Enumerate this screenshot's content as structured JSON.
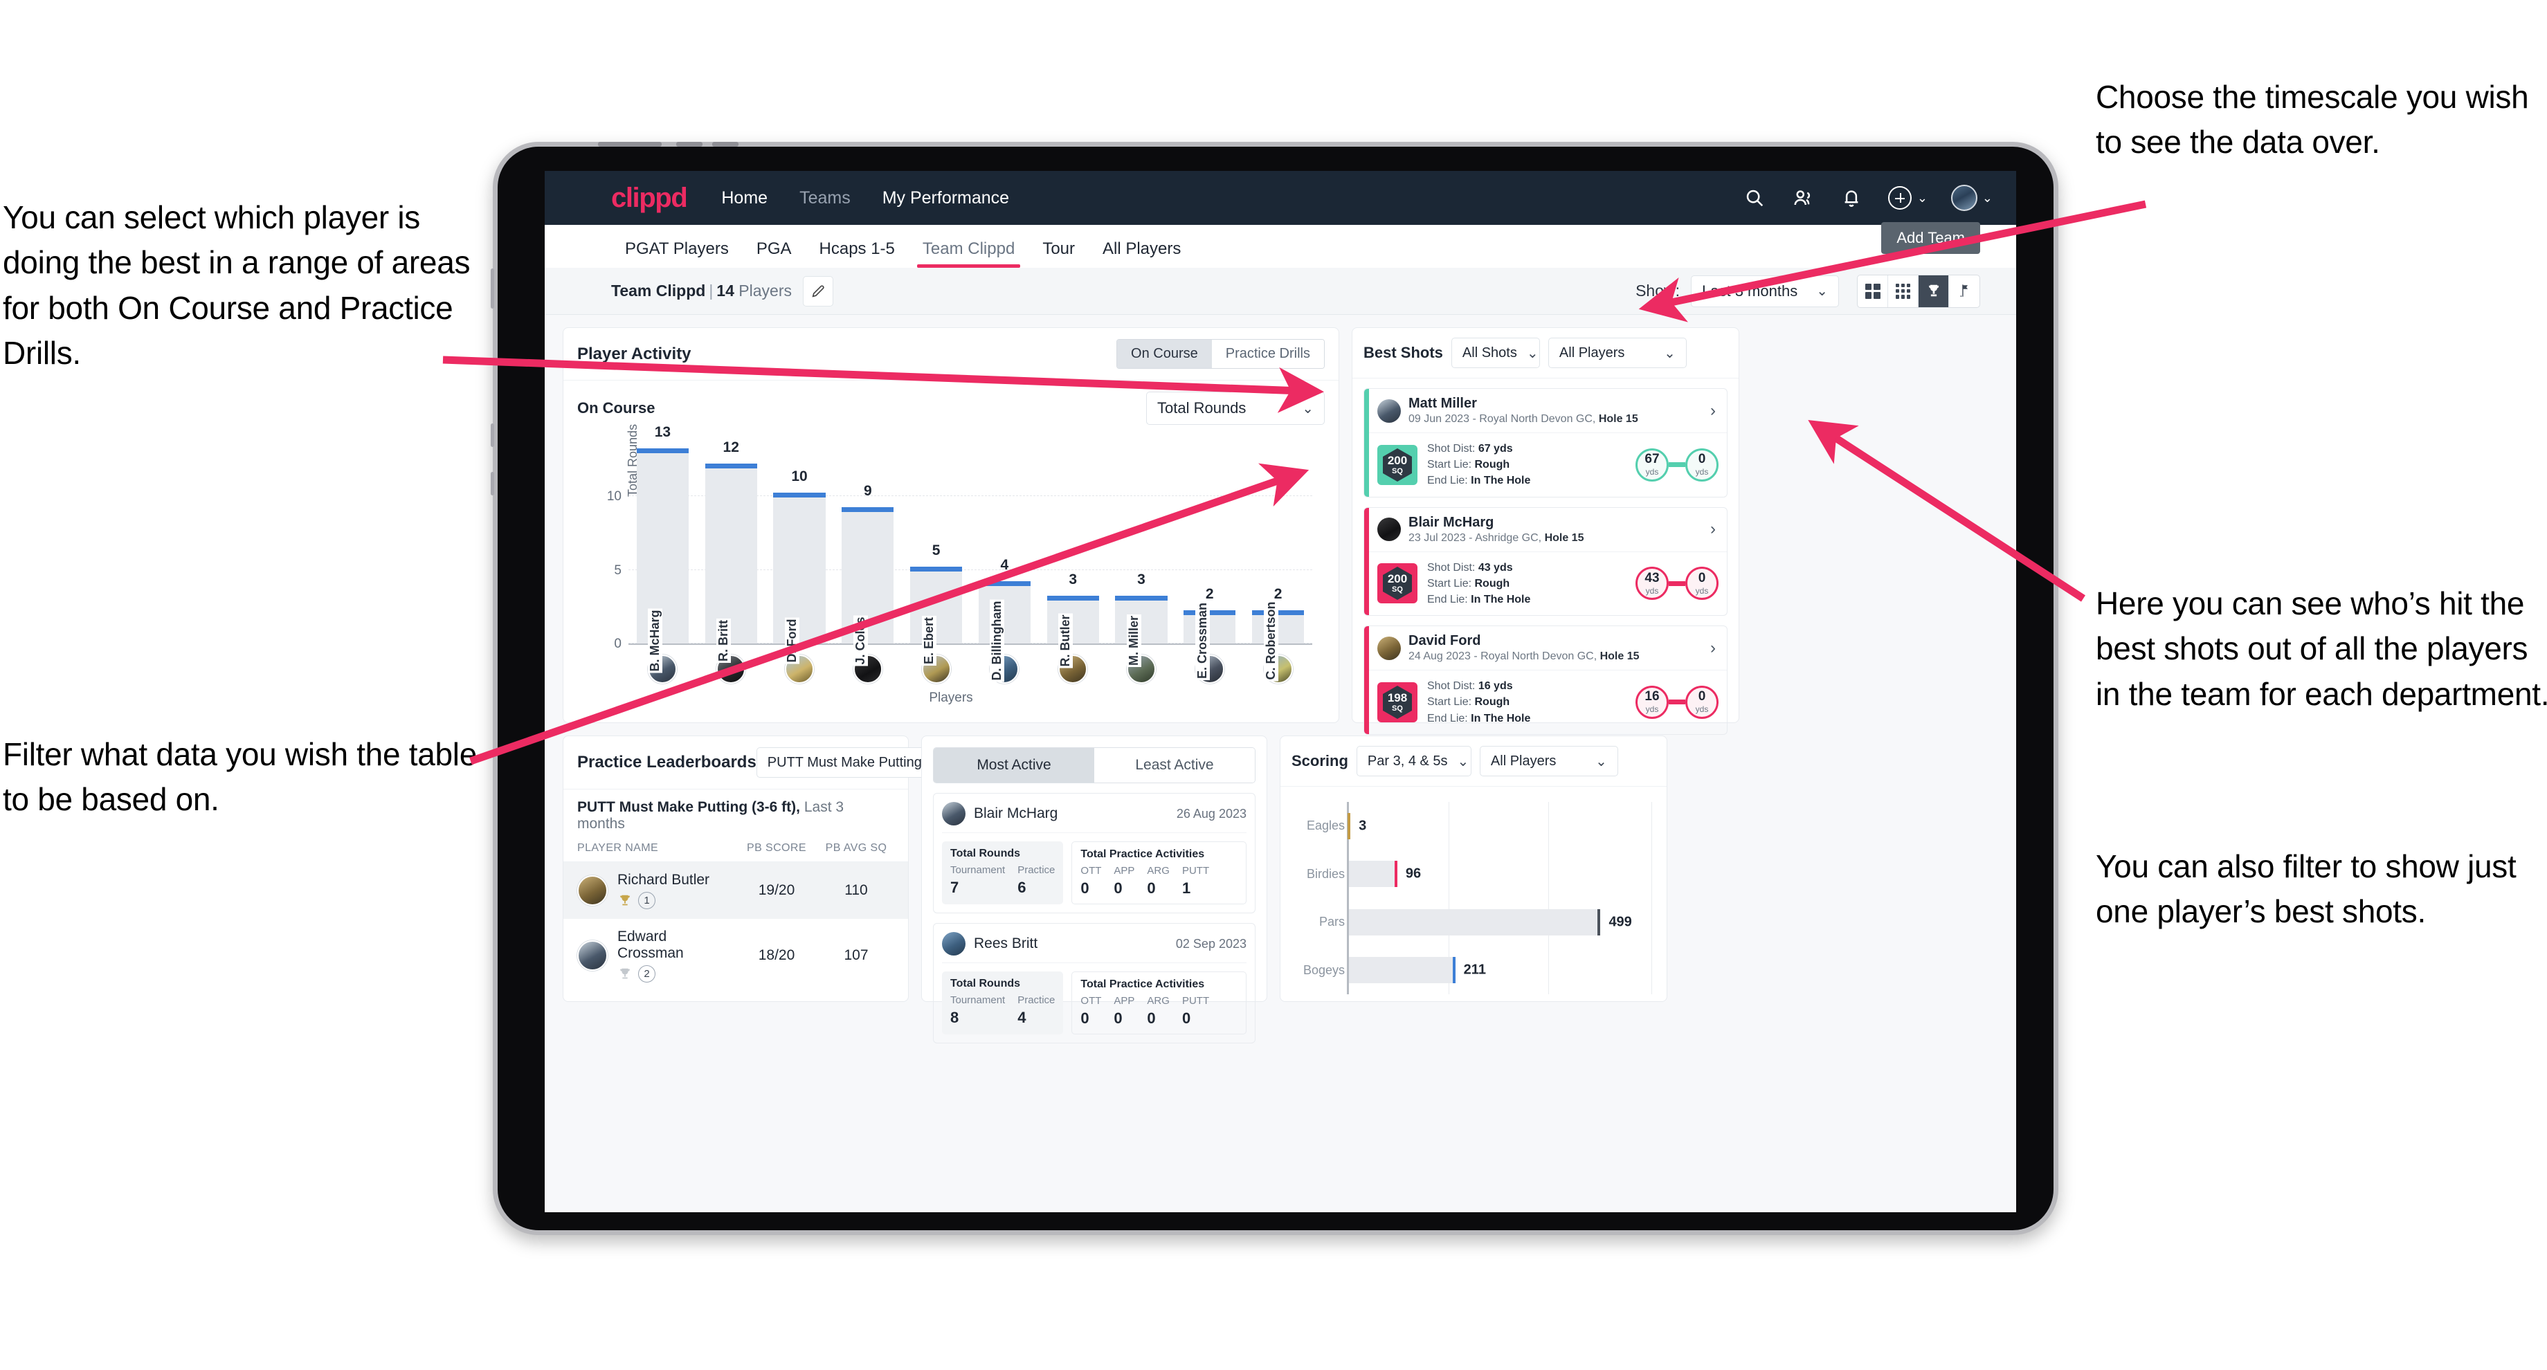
{
  "annotations": {
    "left_top": "You can select which player is doing the best in a range of areas for both On Course and Practice Drills.",
    "left_bottom": "Filter what data you wish the table to be based on.",
    "right_top": "Choose the timescale you wish to see the data over.",
    "right_middle": "Here you can see who’s hit the best shots out of all the players in the team for each department.",
    "right_bottom": "You can also filter to show just one player’s best shots."
  },
  "topnav": {
    "logo": "clippd",
    "links": [
      {
        "label": "Home",
        "dim": false
      },
      {
        "label": "Teams",
        "dim": true
      },
      {
        "label": "My Performance",
        "dim": false
      }
    ],
    "icons": [
      "search-icon",
      "people-icon",
      "bell-icon",
      "plus-circle-icon",
      "avatar"
    ]
  },
  "tabs": [
    {
      "label": "PGAT Players",
      "active": false
    },
    {
      "label": "PGA",
      "active": false
    },
    {
      "label": "Hcaps 1-5",
      "active": false
    },
    {
      "label": "Team Clippd",
      "active": true
    },
    {
      "label": "Tour",
      "active": false
    },
    {
      "label": "All Players",
      "active": false
    }
  ],
  "add_team_button": "Add Team",
  "subheader": {
    "team_label": "Team Clippd",
    "separator": "|",
    "player_count": "14",
    "players_word": "Players",
    "edit_icon": "pencil-icon",
    "show_label": "Show:",
    "show_value": "Last 3 months",
    "view_buttons": [
      "grid-4-icon",
      "grid-9-icon",
      "trophy-icon",
      "flag-icon"
    ],
    "view_selected_index": 2
  },
  "player_activity": {
    "title": "Player Activity",
    "segments": [
      {
        "label": "On Course",
        "active": true
      },
      {
        "label": "Practice Drills",
        "active": false
      }
    ],
    "sub_label": "On Course",
    "metric_select": "Total Rounds"
  },
  "chart_data": [
    {
      "type": "bar",
      "title": "Player Activity",
      "xlabel": "Players",
      "ylabel": "Total Rounds",
      "categories": [
        "B. McHarg",
        "R. Britt",
        "D. Ford",
        "J. Coles",
        "E. Ebert",
        "D. Billingham",
        "R. Butler",
        "M. Miller",
        "E. Crossman",
        "C. Robertson"
      ],
      "values": [
        13,
        12,
        10,
        9,
        5,
        4,
        3,
        3,
        2,
        2
      ],
      "ylim": [
        0,
        14
      ],
      "yticks": [
        0,
        5,
        10
      ],
      "grid": true,
      "bar_color": "#e7eaee",
      "cap_color": "#3d7fd6"
    },
    {
      "type": "bar",
      "title": "Scoring",
      "orientation": "horizontal",
      "categories": [
        "Eagles",
        "Birdies",
        "Pars",
        "Bogeys"
      ],
      "values": [
        3,
        96,
        499,
        211
      ],
      "xlim": [
        0,
        600
      ],
      "grid": true,
      "bar_color": "#e8eaee",
      "tip_colors": [
        "#c39b45",
        "#ec2b62",
        "#4b525c",
        "#3d7fd6"
      ]
    }
  ],
  "best_shots": {
    "title": "Best Shots",
    "shots_filter": "All Shots",
    "players_filter": "All Players",
    "items": [
      {
        "player": "Matt Miller",
        "meta_date": "09 Jun 2023 - Royal North Devon GC,",
        "meta_hole": "Hole 15",
        "sq": "200",
        "sq_unit": "SQ",
        "accent": "#54cfae",
        "shot_dist_label": "Shot Dist:",
        "shot_dist": "67 yds",
        "start_lie_label": "Start Lie:",
        "start_lie": "Rough",
        "end_lie_label": "End Lie:",
        "end_lie": "In The Hole",
        "from_value": "67",
        "from_unit": "yds",
        "to_value": "0",
        "to_unit": "yds"
      },
      {
        "player": "Blair McHarg",
        "meta_date": "23 Jul 2023 - Ashridge GC,",
        "meta_hole": "Hole 15",
        "sq": "200",
        "sq_unit": "SQ",
        "accent": "#ec2b62",
        "shot_dist_label": "Shot Dist:",
        "shot_dist": "43 yds",
        "start_lie_label": "Start Lie:",
        "start_lie": "Rough",
        "end_lie_label": "End Lie:",
        "end_lie": "In The Hole",
        "from_value": "43",
        "from_unit": "yds",
        "to_value": "0",
        "to_unit": "yds"
      },
      {
        "player": "David Ford",
        "meta_date": "24 Aug 2023 - Royal North Devon GC,",
        "meta_hole": "Hole 15",
        "sq": "198",
        "sq_unit": "SQ",
        "accent": "#ec2b62",
        "shot_dist_label": "Shot Dist:",
        "shot_dist": "16 yds",
        "start_lie_label": "Start Lie:",
        "start_lie": "Rough",
        "end_lie_label": "End Lie:",
        "end_lie": "In The Hole",
        "from_value": "16",
        "from_unit": "yds",
        "to_value": "0",
        "to_unit": "yds"
      }
    ]
  },
  "practice_leaderboards": {
    "title": "Practice Leaderboards",
    "drill_select": "PUTT Must Make Putting ...",
    "subtitle_bold": "PUTT Must Make Putting (3-6 ft),",
    "subtitle_light": "Last 3 months",
    "columns": [
      "PLAYER NAME",
      "PB SCORE",
      "PB AVG SQ"
    ],
    "rows": [
      {
        "name": "Richard Butler",
        "rank": "1",
        "trophy": "gold",
        "pb_score": "19/20",
        "pb_avg_sq": "110",
        "highlight": true
      },
      {
        "name": "Edward Crossman",
        "rank": "2",
        "trophy": "silver",
        "pb_score": "18/20",
        "pb_avg_sq": "107",
        "highlight": false
      }
    ]
  },
  "activity": {
    "tabs": [
      {
        "label": "Most Active",
        "active": true
      },
      {
        "label": "Least Active",
        "active": false
      }
    ],
    "cards": [
      {
        "name": "Blair McHarg",
        "date": "26 Aug 2023",
        "rounds_title": "Total Rounds",
        "rounds": [
          {
            "key": "Tournament",
            "value": "7"
          },
          {
            "key": "Practice",
            "value": "6"
          }
        ],
        "practice_title": "Total Practice Activities",
        "practice": [
          {
            "key": "OTT",
            "value": "0"
          },
          {
            "key": "APP",
            "value": "0"
          },
          {
            "key": "ARG",
            "value": "0"
          },
          {
            "key": "PUTT",
            "value": "1"
          }
        ]
      },
      {
        "name": "Rees Britt",
        "date": "02 Sep 2023",
        "rounds_title": "Total Rounds",
        "rounds": [
          {
            "key": "Tournament",
            "value": "8"
          },
          {
            "key": "Practice",
            "value": "4"
          }
        ],
        "practice_title": "Total Practice Activities",
        "practice": [
          {
            "key": "OTT",
            "value": "0"
          },
          {
            "key": "APP",
            "value": "0"
          },
          {
            "key": "ARG",
            "value": "0"
          },
          {
            "key": "PUTT",
            "value": "0"
          }
        ]
      }
    ]
  },
  "scoring": {
    "title": "Scoring",
    "par_filter": "Par 3, 4 & 5s",
    "players_filter": "All Players"
  },
  "colors": {
    "brand_pink": "#ec2b62",
    "nav_dark": "#1b2735",
    "bar_blue": "#3d7fd6",
    "teal": "#54cfae"
  }
}
